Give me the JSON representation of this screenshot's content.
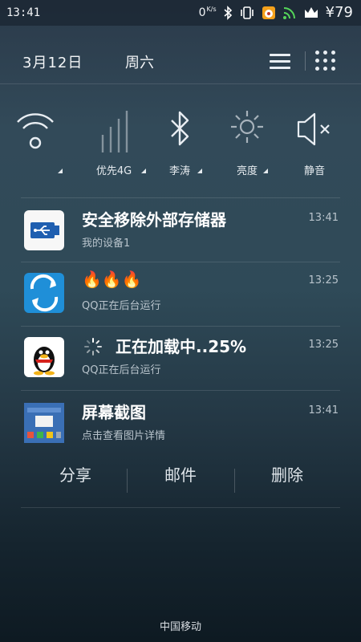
{
  "status_bar": {
    "time": "13:41",
    "net_speed": "0",
    "net_speed_unit": "K/s",
    "balance": "¥79"
  },
  "header": {
    "date": "3月12日",
    "weekday": "周六"
  },
  "toggles": [
    {
      "icon": "wifi-icon",
      "label": ""
    },
    {
      "icon": "signal-bars-icon",
      "label": "优先4G"
    },
    {
      "icon": "bluetooth-icon",
      "label": "李涛"
    },
    {
      "icon": "brightness-icon",
      "label": "亮度"
    },
    {
      "icon": "mute-icon",
      "label": "静音"
    }
  ],
  "notifications": [
    {
      "icon": "usb-icon",
      "title": "安全移除外部存储器",
      "subtitle": "我的设备1",
      "time": "13:41"
    },
    {
      "icon": "sync-app-icon",
      "title": "🔥🔥🔥",
      "subtitle": "QQ正在后台运行",
      "time": "13:25"
    },
    {
      "icon": "qq-penguin-icon",
      "title": "正在加载中..25%",
      "subtitle": "QQ正在后台运行",
      "time": "13:25"
    },
    {
      "icon": "screenshot-thumbnail-icon",
      "title": "屏幕截图",
      "subtitle": "点击查看图片详情",
      "time": "13:41"
    }
  ],
  "actions": {
    "share": "分享",
    "mail": "邮件",
    "delete": "删除"
  },
  "carrier": "中国移动",
  "colors": {
    "bg_top": "#2b3a4a",
    "bg_bottom": "#0e1a22",
    "usb_icon_bg": "#f7f7f7",
    "sync_icon_bg": "#1f8fd8",
    "qq_icon_bg": "#ffffff"
  }
}
